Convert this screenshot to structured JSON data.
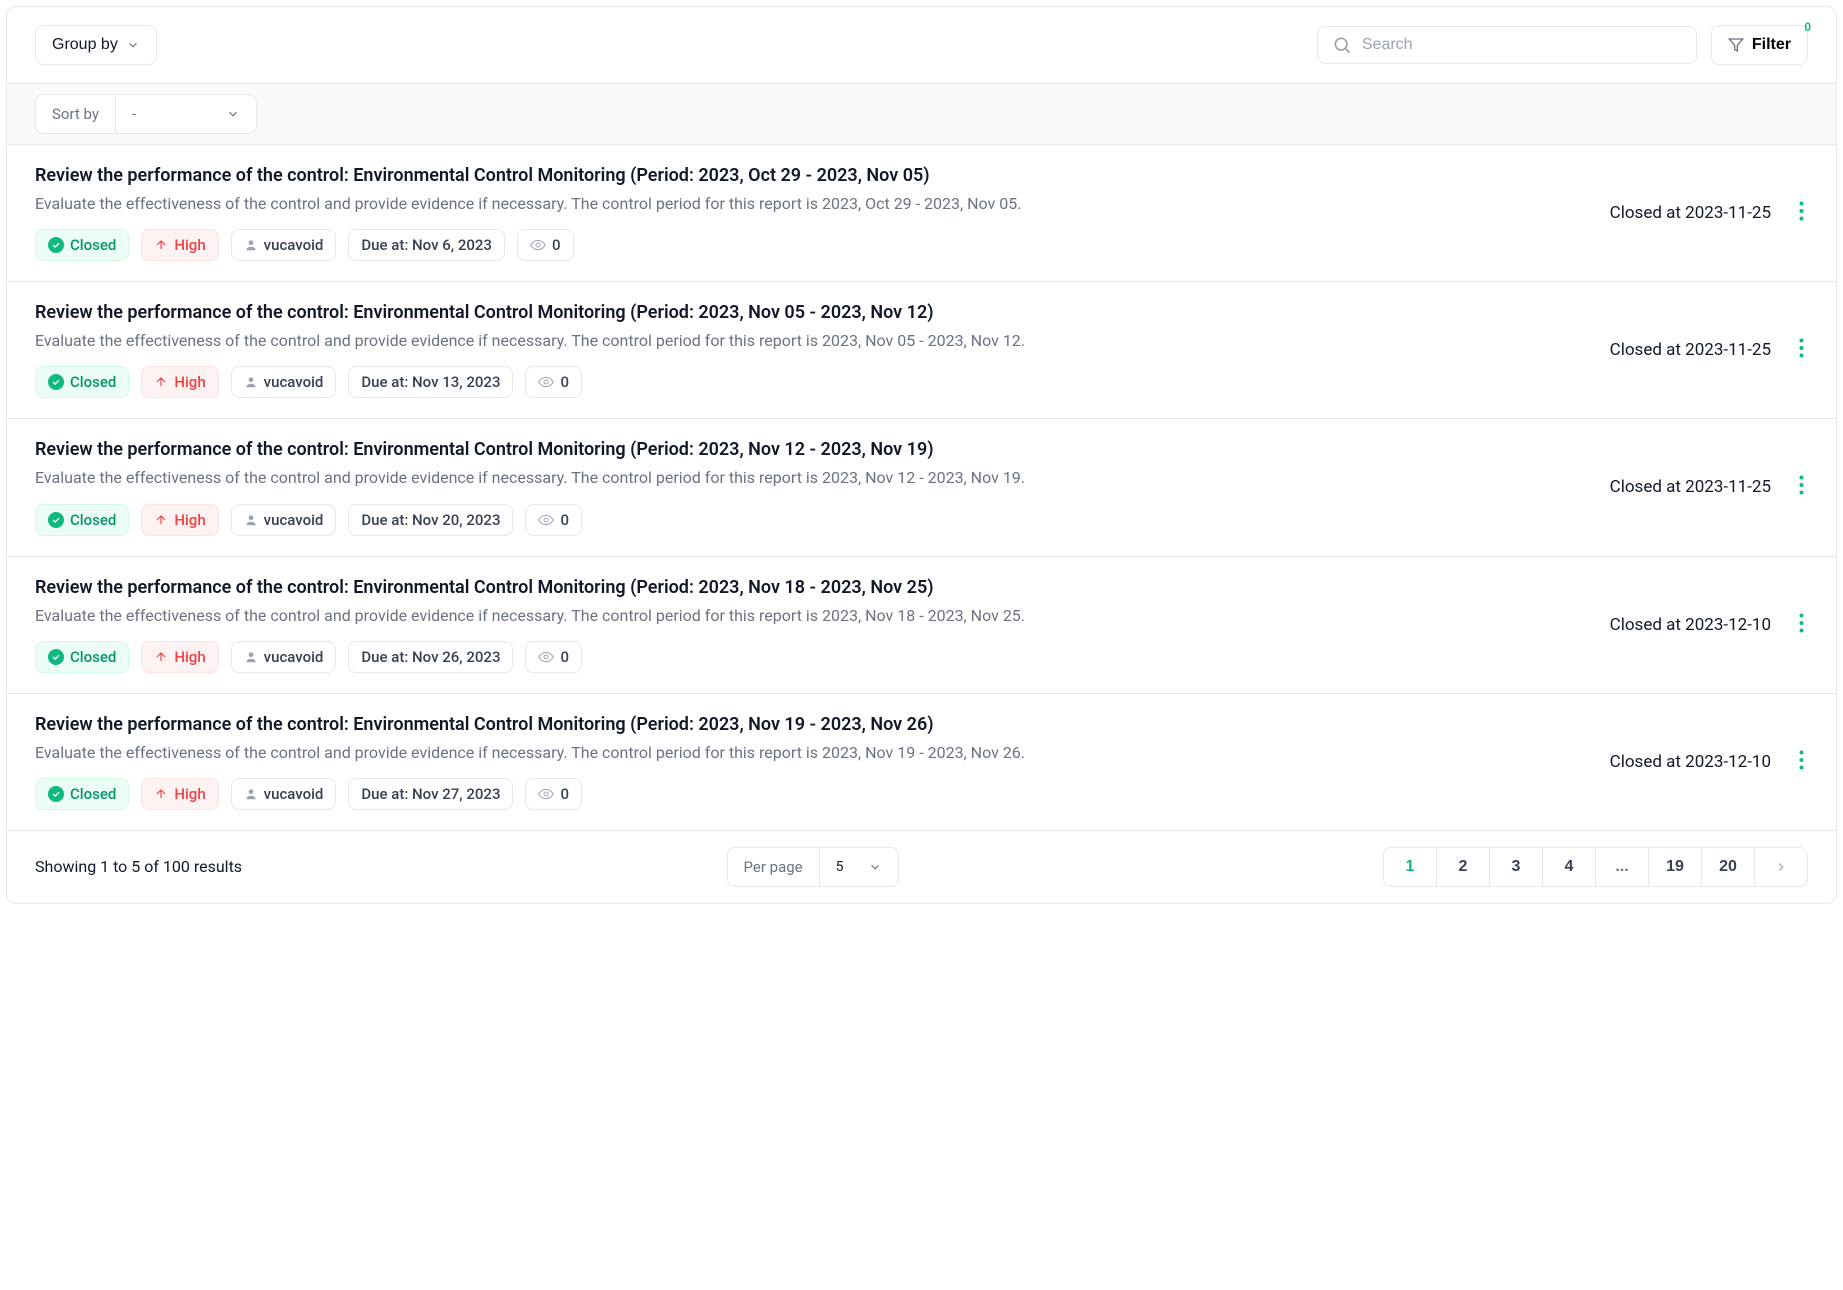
{
  "topbar": {
    "group_by": "Group by",
    "search_placeholder": "Search",
    "filter": "Filter",
    "filter_count": "0"
  },
  "sort": {
    "label": "Sort by",
    "value": "-"
  },
  "items": [
    {
      "title": "Review the performance of the control: Environmental Control Monitoring (Period: 2023, Oct 29 - 2023, Nov 05)",
      "desc": "Evaluate the effectiveness of the control and provide evidence if necessary. The control period for this report is 2023, Oct 29 - 2023, Nov 05.",
      "status": "Closed",
      "priority": "High",
      "user": "vucavoid",
      "due": "Due at: Nov 6, 2023",
      "watchers": "0",
      "closed_at": "Closed at 2023-11-25"
    },
    {
      "title": "Review the performance of the control: Environmental Control Monitoring (Period: 2023, Nov 05 - 2023, Nov 12)",
      "desc": "Evaluate the effectiveness of the control and provide evidence if necessary. The control period for this report is 2023, Nov 05 - 2023, Nov 12.",
      "status": "Closed",
      "priority": "High",
      "user": "vucavoid",
      "due": "Due at: Nov 13, 2023",
      "watchers": "0",
      "closed_at": "Closed at 2023-11-25"
    },
    {
      "title": "Review the performance of the control: Environmental Control Monitoring (Period: 2023, Nov 12 - 2023, Nov 19)",
      "desc": "Evaluate the effectiveness of the control and provide evidence if necessary. The control period for this report is 2023, Nov 12 - 2023, Nov 19.",
      "status": "Closed",
      "priority": "High",
      "user": "vucavoid",
      "due": "Due at: Nov 20, 2023",
      "watchers": "0",
      "closed_at": "Closed at 2023-11-25"
    },
    {
      "title": "Review the performance of the control: Environmental Control Monitoring (Period: 2023, Nov 18 - 2023, Nov 25)",
      "desc": "Evaluate the effectiveness of the control and provide evidence if necessary. The control period for this report is 2023, Nov 18 - 2023, Nov 25.",
      "status": "Closed",
      "priority": "High",
      "user": "vucavoid",
      "due": "Due at: Nov 26, 2023",
      "watchers": "0",
      "closed_at": "Closed at 2023-12-10"
    },
    {
      "title": "Review the performance of the control: Environmental Control Monitoring (Period: 2023, Nov 19 - 2023, Nov 26)",
      "desc": "Evaluate the effectiveness of the control and provide evidence if necessary. The control period for this report is 2023, Nov 19 - 2023, Nov 26.",
      "status": "Closed",
      "priority": "High",
      "user": "vucavoid",
      "due": "Due at: Nov 27, 2023",
      "watchers": "0",
      "closed_at": "Closed at 2023-12-10"
    }
  ],
  "pagination": {
    "showing": "Showing 1 to 5 of 100 results",
    "perpage_label": "Per page",
    "perpage_value": "5",
    "pages": [
      "1",
      "2",
      "3",
      "4",
      "...",
      "19",
      "20"
    ],
    "active": "1"
  }
}
